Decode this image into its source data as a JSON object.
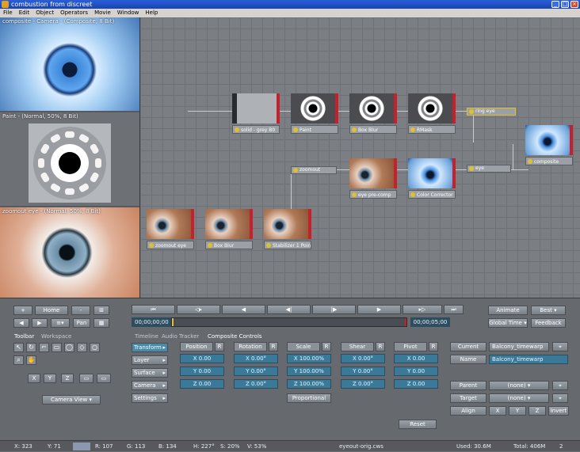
{
  "window": {
    "title": "combustion from discreet"
  },
  "menu": [
    "File",
    "Edit",
    "Object",
    "Operators",
    "Movie",
    "Window",
    "Help"
  ],
  "viewers": {
    "top_label": "composite - Camera - (Composite, 8 Bit)",
    "middle_label": "Paint - (Normal, 50%, 8 Bit)",
    "bottom_label": "zoomout eye - (Normal, 50%, 8 Bit)"
  },
  "graph": {
    "nodes": [
      {
        "label": "solid - grey B0"
      },
      {
        "label": "Paint"
      },
      {
        "label": "Box Blur"
      },
      {
        "label": "RMask"
      },
      {
        "label": "composite"
      },
      {
        "label": "eye pre-comp"
      },
      {
        "label": "Color Corrector"
      },
      {
        "label": "zoomout eye"
      },
      {
        "label": "Box Blur"
      },
      {
        "label": "Stabilizer 1 Point"
      }
    ],
    "pills": [
      {
        "label": "ring eye"
      },
      {
        "label": "zoomout"
      },
      {
        "label": "eye"
      }
    ]
  },
  "nav": {
    "plus": "+",
    "home": "Home",
    "minus": "-",
    "pan": "Pan"
  },
  "transport": {
    "timecode_start": "00;00;00;00",
    "timecode_end": "00;00;05;00"
  },
  "right_top": {
    "animate": "Animate",
    "best": "Best",
    "global_time": "Global Time",
    "feedback": "Feedback"
  },
  "tabs": {
    "left": [
      "Toolbar",
      "Workspace"
    ],
    "middle": [
      "Timeline",
      "Audio",
      "Tracker",
      "Composite Controls"
    ]
  },
  "axes": {
    "x": "X",
    "y": "Y",
    "z": "Z"
  },
  "camera_view": "Camera View",
  "side_buttons": [
    "Transform",
    "Layer",
    "Surface",
    "Camera",
    "Settings"
  ],
  "columns": [
    {
      "header": "Position",
      "x": "X 0.00",
      "y": "Y 0.00",
      "z": "Z 0.00"
    },
    {
      "header": "Rotation",
      "x": "X 0.00°",
      "y": "Y 0.00°",
      "z": "Z 0.00°"
    },
    {
      "header": "Scale",
      "x": "X 100.00%",
      "y": "Y 100.00%",
      "z": "Z 100.00%"
    },
    {
      "header": "Shear",
      "x": "X 0.00°",
      "y": "Y 0.00°",
      "z": "Z 0.00°"
    },
    {
      "header": "Pivot",
      "x": "X 0.00",
      "y": "Y 0.00",
      "z": "Z 0.00"
    }
  ],
  "r_label": "R",
  "proportional": "Proportional",
  "reset": "Reset",
  "object_panel": {
    "current_label": "Current",
    "current_value": "Balcony_timewarp",
    "name_label": "Name",
    "name_value": "Balcony_timewarp",
    "parent_label": "Parent",
    "parent_value": "(none)",
    "target_label": "Target",
    "target_value": "(none)",
    "align_label": "Align",
    "invert": "Invert"
  },
  "status": {
    "x": "X:  323",
    "y": "Y:  71",
    "r": "R:  107",
    "g": "G:  113",
    "b": "B:  134",
    "h": "H:  227°",
    "s": "S:  20%",
    "v": "V:  53%",
    "file": "eyeout-orig.cws",
    "used": "Used:  30.6M",
    "total": "Total:  406M",
    "page": "2"
  },
  "colors": {
    "accent": "#3a7a98",
    "node_flag": "#c8202a",
    "graph_bg": "#7b7f84"
  }
}
